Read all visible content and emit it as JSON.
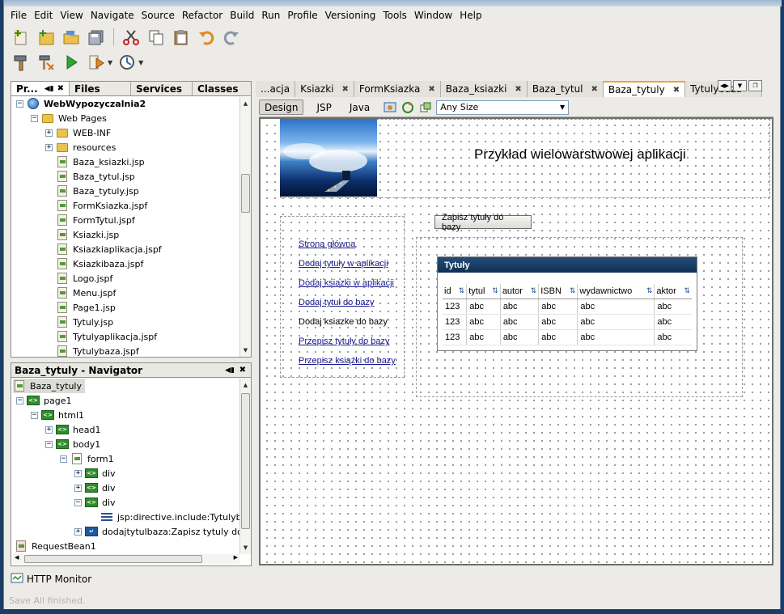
{
  "menu": [
    "File",
    "Edit",
    "View",
    "Navigate",
    "Source",
    "Refactor",
    "Build",
    "Run",
    "Profile",
    "Versioning",
    "Tools",
    "Window",
    "Help"
  ],
  "project_tabs": [
    "Pr...",
    "Files",
    "Services",
    "Classes"
  ],
  "project_tree": {
    "root": "WebWypozyczalnia2",
    "web_pages": "Web Pages",
    "items": [
      "WEB-INF",
      "resources",
      "Baza_ksiazki.jsp",
      "Baza_tytul.jsp",
      "Baza_tytuly.jsp",
      "FormKsiazka.jspf",
      "FormTytul.jspf",
      "Ksiazki.jsp",
      "Ksiazkiaplikacja.jspf",
      "Ksiazkibaza.jspf",
      "Logo.jspf",
      "Menu.jspf",
      "Page1.jsp",
      "Tytuly.jsp",
      "Tytulyaplikacja.jspf",
      "Tytulybaza.jspf"
    ]
  },
  "navigator": {
    "title": "Baza_tytuly - Navigator",
    "items": [
      "Baza_tytuly",
      "page1",
      "html1",
      "head1",
      "body1",
      "form1",
      "div",
      "div",
      "div",
      "jsp:directive.include:Tytulyba",
      "dodajtytulbaza:Zapisz tytuly do b",
      "RequestBean1"
    ]
  },
  "editor_tabs": [
    "...acja",
    "Ksiazki",
    "FormKsiazka",
    "Baza_ksiazki",
    "Baza_tytul",
    "Baza_tytuly",
    "Tytulybaza"
  ],
  "active_editor_tab": "Baza_tytuly",
  "design_bar": {
    "modes": [
      "Design",
      "JSP",
      "Java"
    ],
    "size_select": "Any Size"
  },
  "page": {
    "heading": "Przykład wielowarstwowej aplikacji",
    "save_button": "Zapisz tytuły do bazy",
    "menu_links": [
      "Strona główna",
      "Dodaj tytuły w aplikacji",
      "Dodaj ksiazki w aplikacji",
      "Dodaj tytuł do bazy",
      "Dodaj ksiazke do bazy",
      "Przepisz tytuły do bazy",
      "Przepisz książki do bazy"
    ],
    "table": {
      "title": "Tytuły",
      "columns": [
        "id",
        "tytul",
        "autor",
        "ISBN",
        "wydawnictwo",
        "aktor"
      ],
      "rows": [
        [
          "123",
          "abc",
          "abc",
          "abc",
          "abc",
          "abc"
        ],
        [
          "123",
          "abc",
          "abc",
          "abc",
          "abc",
          "abc"
        ],
        [
          "123",
          "abc",
          "abc",
          "abc",
          "abc",
          "abc"
        ]
      ]
    }
  },
  "bottom_tab": "HTTP Monitor",
  "status": "Save All finished."
}
